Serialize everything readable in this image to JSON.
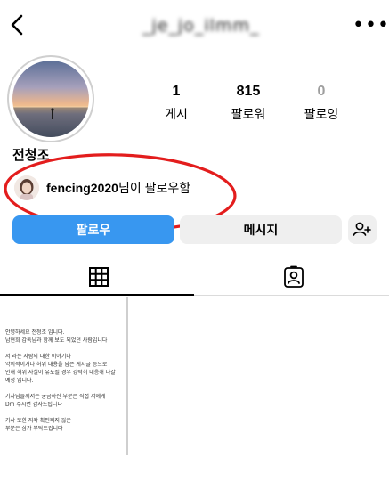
{
  "header": {
    "username": "_je_jo_ilmm_"
  },
  "icons": {
    "back": "chevron-left-icon",
    "more": "more-horizontal-icon",
    "add_person": "add-person-icon",
    "grid": "grid-icon",
    "tagged": "tagged-person-icon"
  },
  "profile": {
    "name": "전청조",
    "stats": [
      {
        "value": "1",
        "label": "게시"
      },
      {
        "value": "815",
        "label": "팔로워"
      },
      {
        "value": "0",
        "label": "팔로잉"
      }
    ]
  },
  "followed_by": {
    "username": "fencing2020",
    "suffix": "님이 팔로우함"
  },
  "buttons": {
    "follow": "팔로우",
    "message": "메시지"
  },
  "post_text": [
    "안녕하세요 전청조 입니다.",
    "남현희 감독님과 함께 보도 되었던 사람입니다",
    "저 라는 사람의 대한 이야기나",
    "악의적이거나 허위 내용을 담은 게시글 등으로",
    "인해 허위 사실이 유포될 경우 강력히 대응해 나갈",
    "예정 입니다.",
    "기자님들께서는 궁금하신 부분은 직접 저에게",
    "Dm 주시면 감사드립니다",
    "기사 또한 저와 확인되지 않은",
    "부분은 삼가 부탁드립니다"
  ],
  "colors": {
    "follow_button": "#3897f0",
    "secondary_button": "#efefef",
    "annotation": "#e31d1d"
  }
}
